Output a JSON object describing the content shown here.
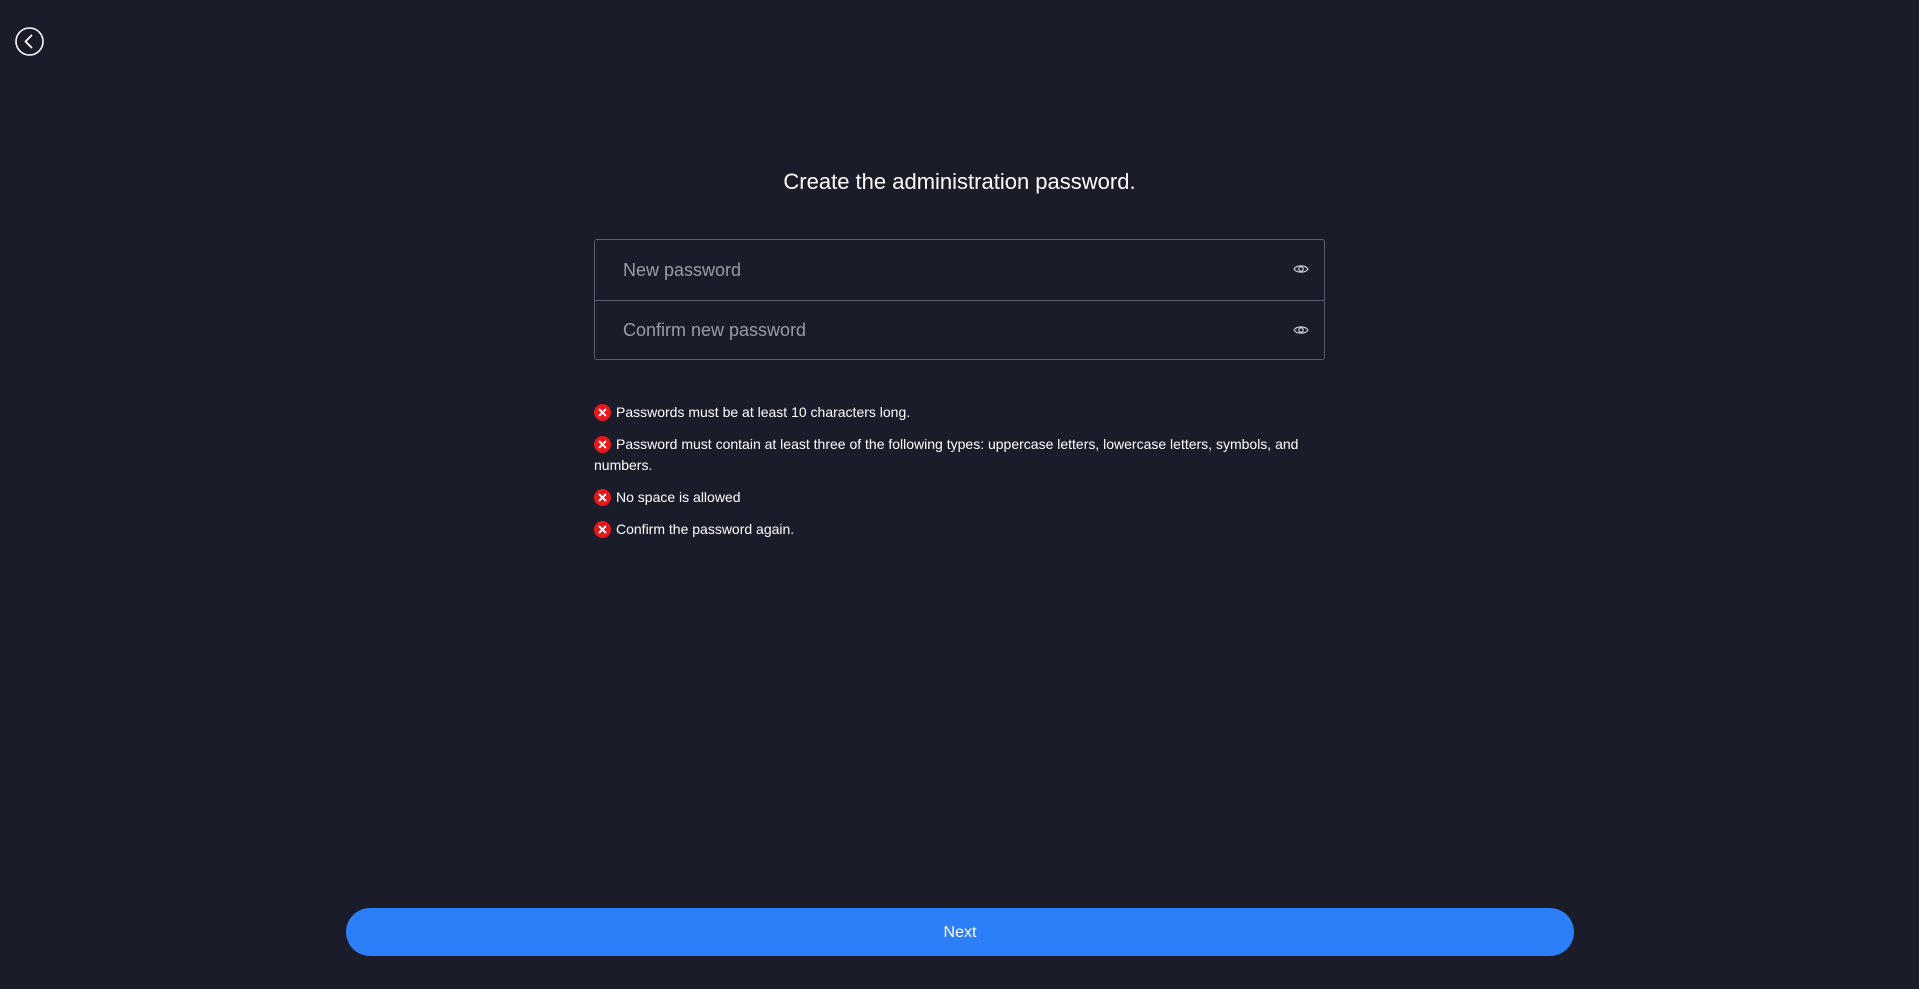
{
  "header": {
    "back_icon": "chevron-left-circle-icon"
  },
  "main": {
    "title": "Create the administration password.",
    "fields": {
      "new_password": {
        "placeholder": "New password",
        "value": "",
        "toggle_icon": "eye-icon"
      },
      "confirm_password": {
        "placeholder": "Confirm new password",
        "value": "",
        "toggle_icon": "eye-icon"
      }
    },
    "rules": [
      {
        "text": "Passwords must be at least 10 characters long.",
        "status": "error"
      },
      {
        "text": "Password must contain at least three of the following types: uppercase letters, lowercase letters, symbols, and numbers.",
        "status": "error"
      },
      {
        "text": "No space is allowed",
        "status": "error"
      },
      {
        "text": "Confirm the password again.",
        "status": "error"
      }
    ]
  },
  "footer": {
    "next_label": "Next"
  },
  "colors": {
    "background": "#1b1c29",
    "accent": "#2d7ff9",
    "error": "#e5181e",
    "border": "#5a5c6b"
  }
}
